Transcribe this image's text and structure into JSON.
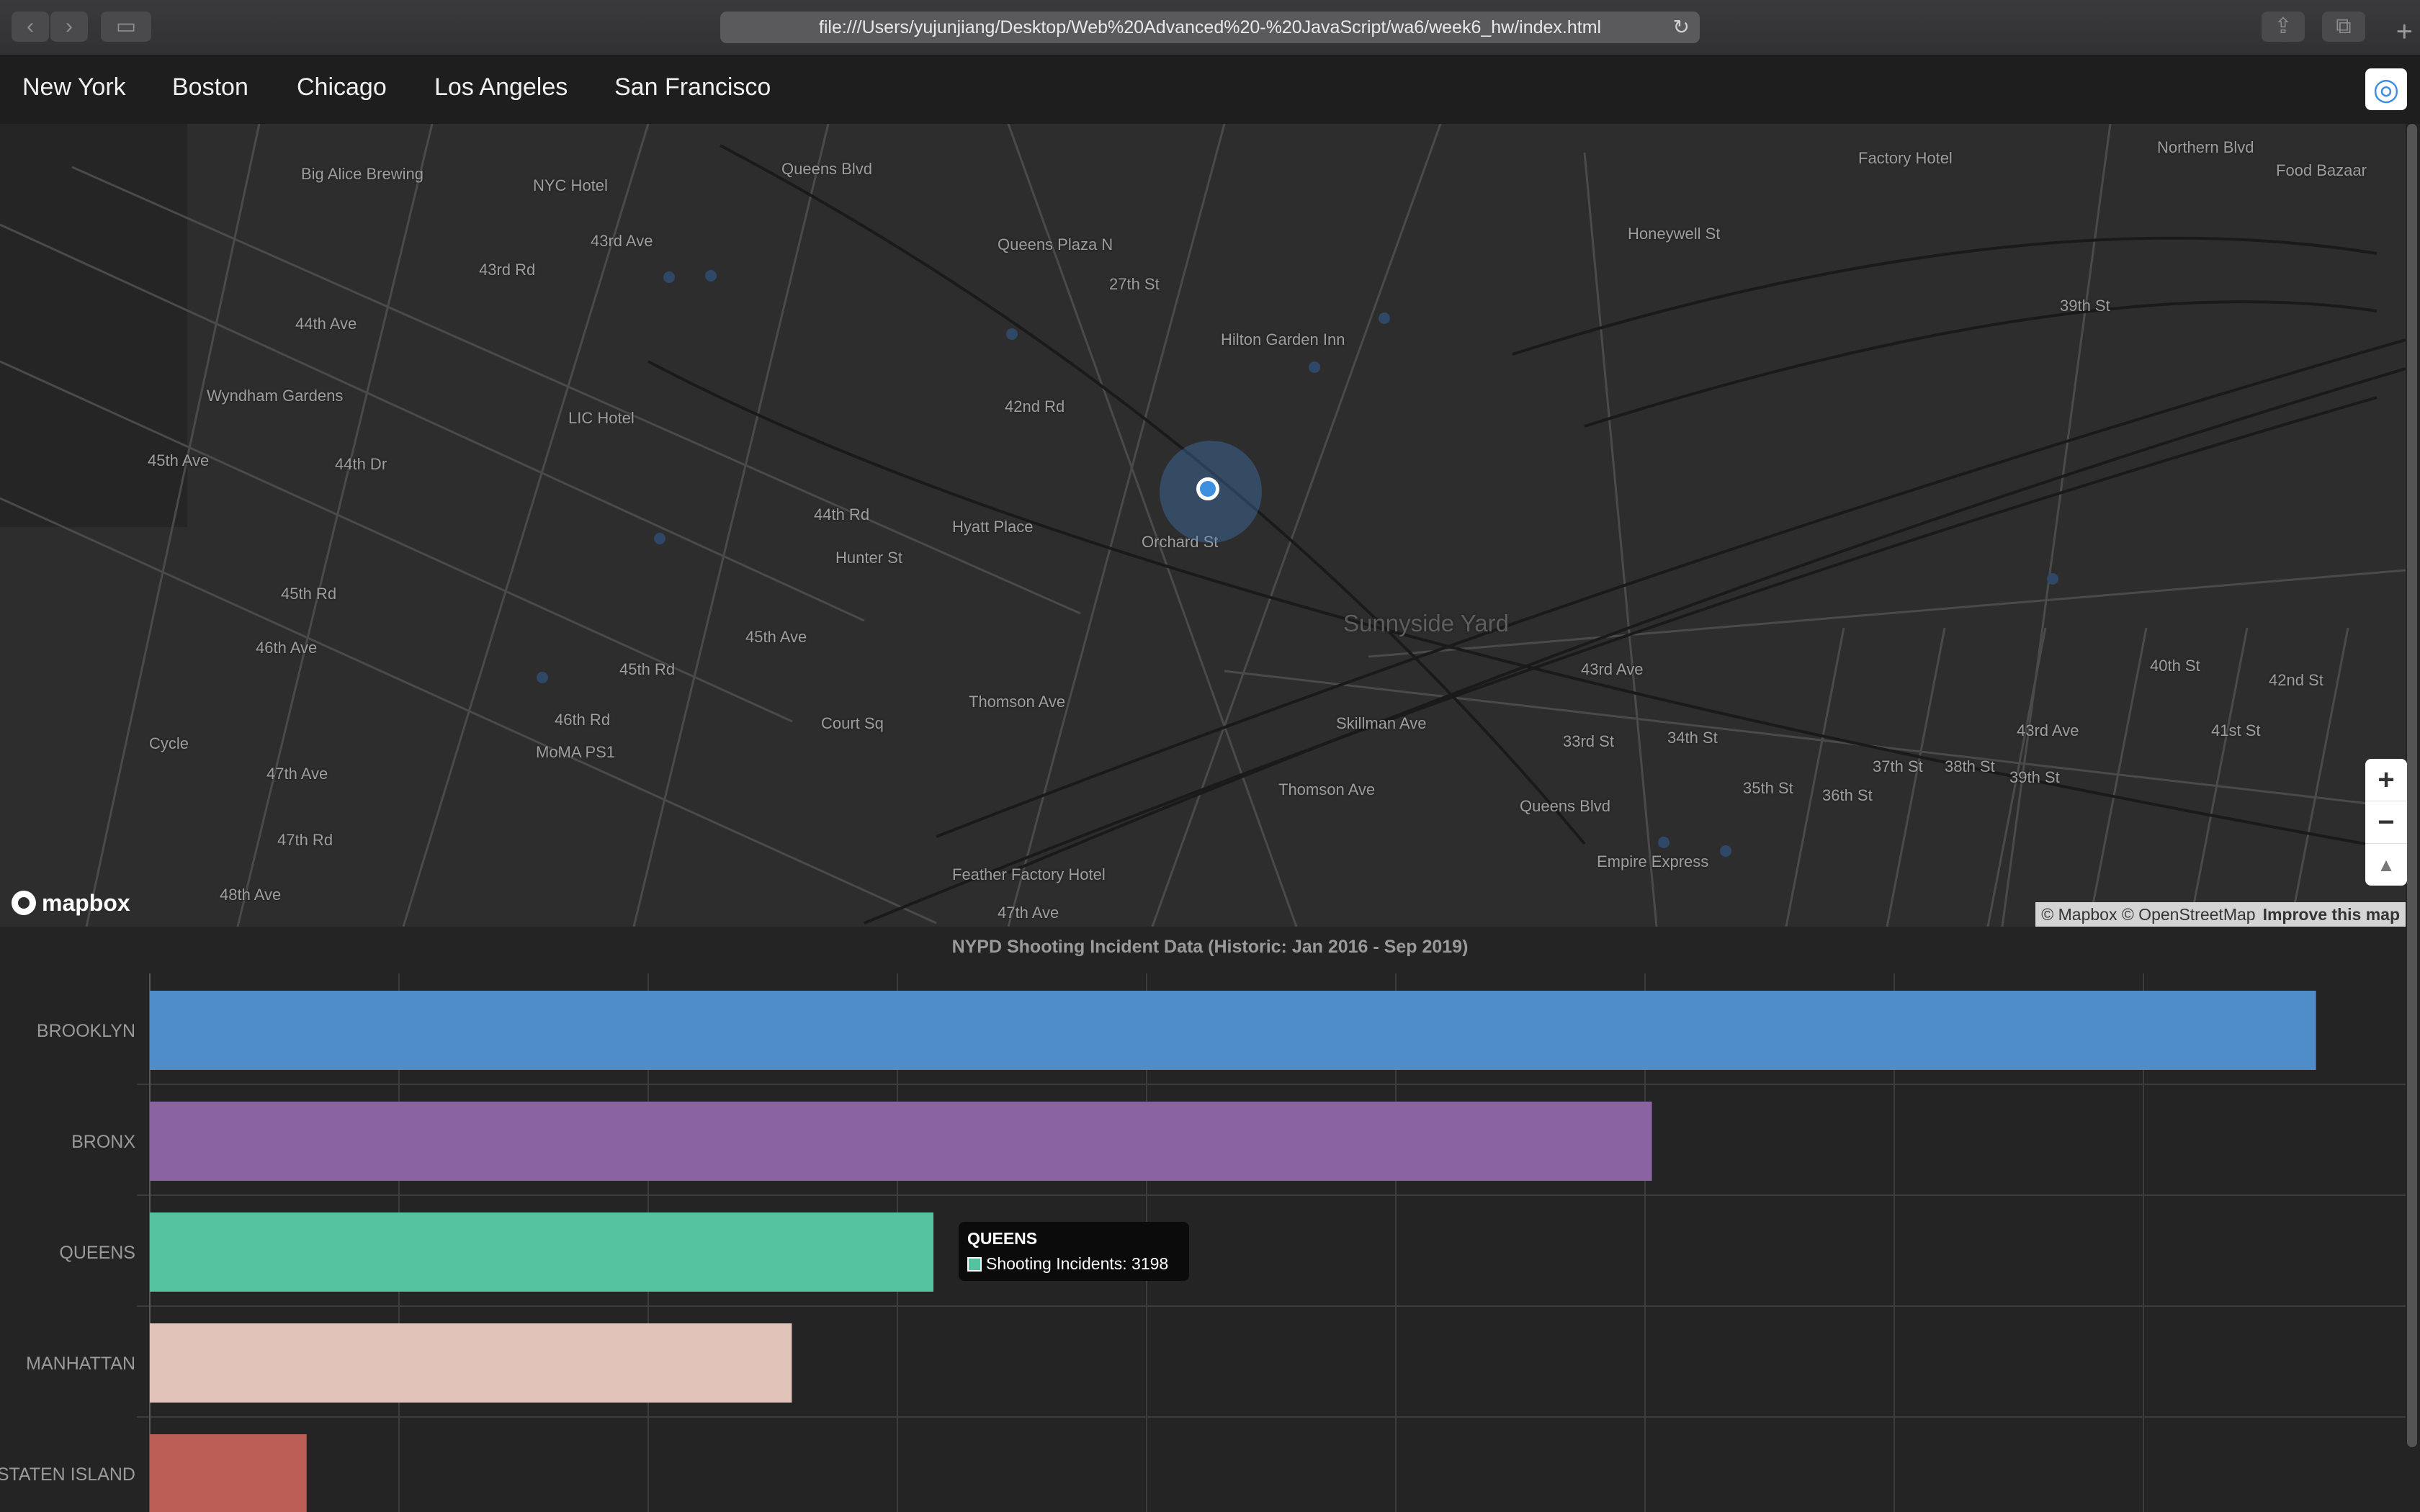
{
  "browser": {
    "url": "file:///Users/yujunjiang/Desktop/Web%20Advanced%20-%20JavaScript/wa6/week6_hw/index.html",
    "back_icon": "chevron-left-icon",
    "forward_icon": "chevron-right-icon",
    "sidebar_icon": "sidebar-icon",
    "reload_icon": "reload-icon",
    "share_icon": "share-icon",
    "tabs_icon": "tabs-icon",
    "new_tab_icon": "plus-icon"
  },
  "nav": {
    "cities": [
      "New York",
      "Boston",
      "Chicago",
      "Los Angeles",
      "San Francisco"
    ]
  },
  "map": {
    "labels": [
      "Big Alice Brewing",
      "NYC Hotel",
      "43rd Ave",
      "43rd Rd",
      "44th Ave",
      "Wyndham Gardens",
      "LIC Hotel",
      "45th Ave",
      "44th Dr",
      "Queens Blvd",
      "Queens Plaza N",
      "27th St",
      "42nd Rd",
      "44th Rd",
      "Hyatt Place",
      "Orchard St",
      "Hunter St",
      "45th Rd",
      "45th Ave",
      "46th Ave",
      "45th Rd",
      "46th Rd",
      "47th Ave",
      "47th Rd",
      "48th Ave",
      "Cycle",
      "MoMA PS1",
      "Thomson Ave",
      "Court Sq",
      "Skillman Ave",
      "Sunnyside Yard",
      "Hilton Garden Inn",
      "Factory Hotel",
      "Food Bazaar",
      "43rd Ave",
      "Thomson Ave",
      "Feather Factory Hotel",
      "Empire Express",
      "47th Ave",
      "Queens Blvd",
      "Honeywell St",
      "39th St",
      "33rd St",
      "34th St",
      "35th St",
      "36th St",
      "37th St",
      "38th St",
      "39th St",
      "40th St",
      "41st St",
      "42nd St",
      "43rd Ave",
      "Northern Blvd"
    ],
    "logo": "mapbox",
    "attribution": "© Mapbox © OpenStreetMap",
    "improve": "Improve this map",
    "controls": {
      "zoom_in": "+",
      "zoom_out": "−",
      "compass": "▲"
    },
    "geolocate_icon": "geolocate-icon"
  },
  "tooltip": {
    "title": "QUEENS",
    "line": "Shooting Incidents: 3198",
    "color": "#55c2a0"
  },
  "chart_data": {
    "type": "bar",
    "orientation": "horizontal",
    "title": "NYPD Shooting Incident Data (Historic: Jan 2016 - Sep 2019)",
    "categories": [
      "BROOKLYN",
      "BRONX",
      "QUEENS",
      "MANHATTAN",
      "STATEN ISLAND"
    ],
    "values": [
      8840,
      6130,
      3198,
      2620,
      640
    ],
    "colors": [
      "#4e8dc9",
      "#8a63a2",
      "#55c2a0",
      "#e2c3b9",
      "#bb5e55"
    ],
    "xlim": [
      0,
      9000
    ],
    "grid": true,
    "legend": "none"
  }
}
